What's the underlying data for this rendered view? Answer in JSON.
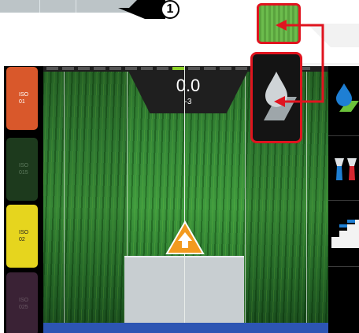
{
  "callout": {
    "number": "1"
  },
  "display": {
    "speed_value": "0.0",
    "speed_offset": "-3"
  },
  "iso_buttons": [
    {
      "label": "ISO\n01",
      "color": "#d9582b"
    },
    {
      "label": "ISO\n015",
      "color": "#1d3a1d"
    },
    {
      "label": "ISO\n02",
      "color": "#e6d51e"
    },
    {
      "label": "ISO\n025",
      "color": "#3a2235"
    }
  ],
  "right_panel": {
    "icons": [
      "drop-on-field-icon",
      "nozzle-pair-icon",
      "stair-steps-icon"
    ]
  },
  "highlight": {
    "color": "#e0141f"
  },
  "colors": {
    "field_green": "#358838",
    "bottom_bar": "#2d55b3",
    "active_segment": "#8bcf28"
  }
}
